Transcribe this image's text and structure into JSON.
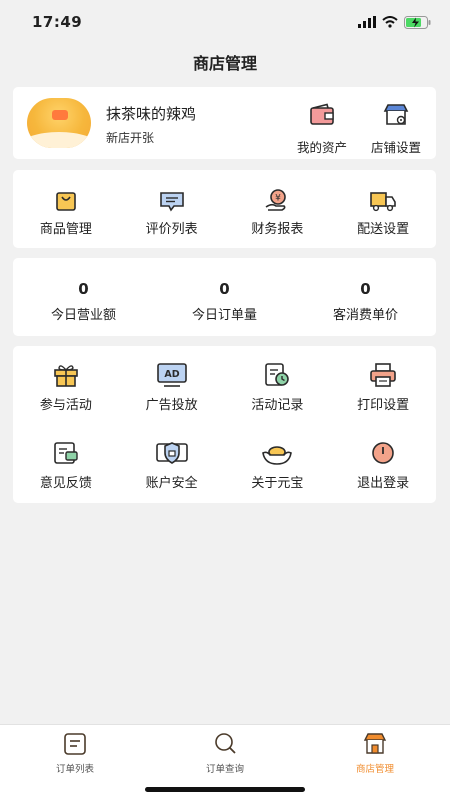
{
  "status": {
    "time": "17:49"
  },
  "header": {
    "title": "商店管理"
  },
  "shop": {
    "name": "抹茶味的辣鸡",
    "subtitle": "新店开张",
    "actions": [
      {
        "label": "我的资产",
        "icon": "wallet-icon"
      },
      {
        "label": "店铺设置",
        "icon": "store-settings-icon"
      }
    ]
  },
  "management": [
    {
      "label": "商品管理",
      "icon": "bag-icon"
    },
    {
      "label": "评价列表",
      "icon": "comment-icon"
    },
    {
      "label": "财务报表",
      "icon": "finance-icon"
    },
    {
      "label": "配送设置",
      "icon": "delivery-truck-icon"
    }
  ],
  "stats": [
    {
      "value": "0",
      "label": "今日营业额"
    },
    {
      "value": "0",
      "label": "今日订单量"
    },
    {
      "value": "0",
      "label": "客消费单价"
    }
  ],
  "tools": [
    {
      "label": "参与活动",
      "icon": "gift-icon"
    },
    {
      "label": "广告投放",
      "icon": "ad-icon",
      "icon_text": "AD"
    },
    {
      "label": "活动记录",
      "icon": "record-clock-icon"
    },
    {
      "label": "打印设置",
      "icon": "printer-icon"
    },
    {
      "label": "意见反馈",
      "icon": "feedback-icon"
    },
    {
      "label": "账户安全",
      "icon": "shield-icon"
    },
    {
      "label": "关于元宝",
      "icon": "ingot-icon"
    },
    {
      "label": "退出登录",
      "icon": "power-icon"
    }
  ],
  "tabbar": [
    {
      "label": "订单列表",
      "icon": "order-list-icon",
      "active": false
    },
    {
      "label": "订单查询",
      "icon": "search-icon",
      "active": false
    },
    {
      "label": "商店管理",
      "icon": "store-icon",
      "active": true
    }
  ],
  "colors": {
    "accent": "#f08c2e",
    "icon_fill": "#f7c654",
    "icon_stroke": "#2b2b2b",
    "background": "#f1f1f1"
  }
}
